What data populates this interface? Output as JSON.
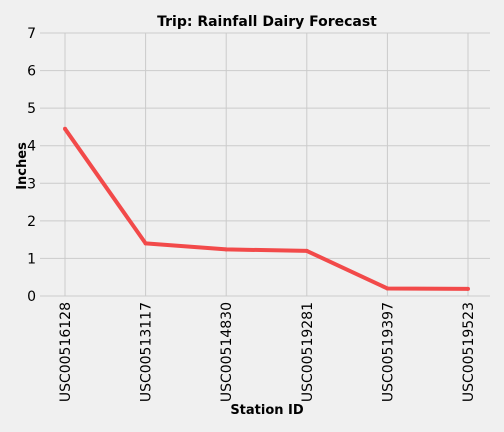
{
  "chart_data": {
    "type": "line",
    "title": "Trip: Rainfall Dairy Forecast",
    "xlabel": "Station ID",
    "ylabel": "Inches",
    "categories": [
      "USC00516128",
      "USC00513117",
      "USC00514830",
      "USC00519281",
      "USC00519397",
      "USC00519523"
    ],
    "series": [
      {
        "values": [
          4.45,
          1.4,
          1.24,
          1.2,
          0.2,
          0.19
        ],
        "color": "#f24a4a"
      }
    ],
    "ylim": [
      0,
      7
    ],
    "yticks": [
      "0",
      "1",
      "2",
      "3",
      "4",
      "5",
      "6",
      "7"
    ],
    "grid": true,
    "legend": false
  },
  "colors": {
    "background": "#f0f0f0",
    "grid": "#cbcbcb",
    "line": "#f24a4a"
  }
}
